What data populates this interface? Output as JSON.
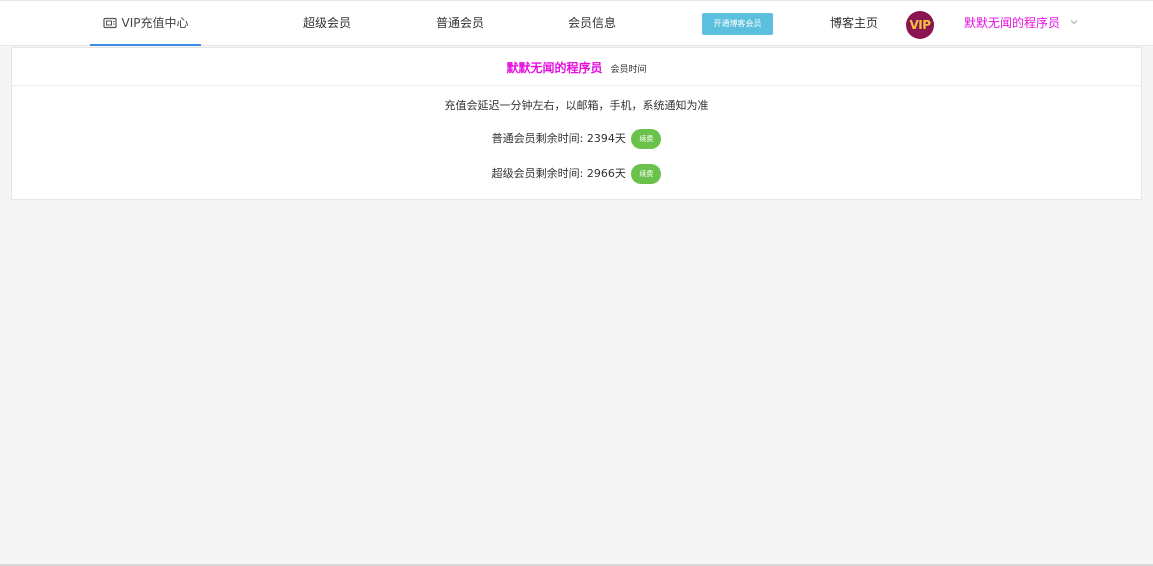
{
  "nav": {
    "home_label": "VIP充值中心",
    "home_icon": "card-icon",
    "super_vip": "超级会员",
    "normal_vip": "普通会员",
    "member_info": "会员信息",
    "open_blog_vip": "开通博客会员",
    "blog_home": "博客主页",
    "vip_badge": "VIP",
    "username": "默默无闻的程序员",
    "username_chevron": "chevron-down-icon",
    "accent_color": "#3a8ee6",
    "user_color": "#e60fe0"
  },
  "panel": {
    "title": "默默无闻的程序员",
    "subtitle": "会员时间",
    "notice": "充值会延迟一分钟左右，以邮箱，手机，系统通知为准",
    "normal_remaining": "普通会员剩余时间: 2394天",
    "super_remaining": "超级会员剩余时间: 2966天",
    "renew_label": "续费",
    "renew_color": "#6ac24a"
  }
}
